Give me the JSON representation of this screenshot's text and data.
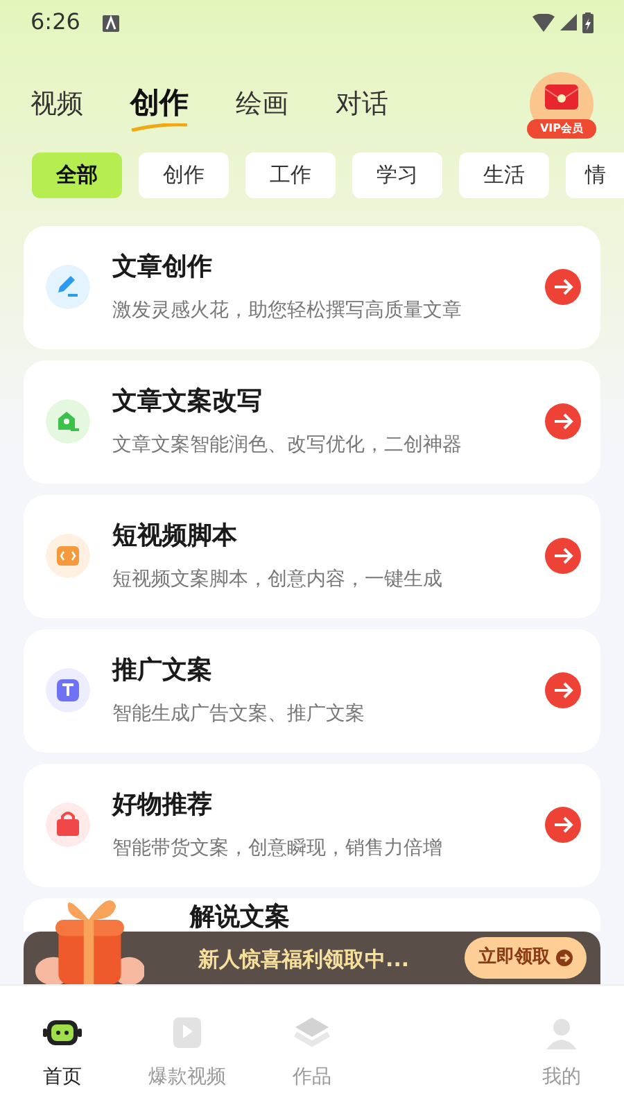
{
  "status_bar": {
    "time": "6:26"
  },
  "top_tabs": [
    {
      "label": "视频",
      "selected": false
    },
    {
      "label": "创作",
      "selected": true
    },
    {
      "label": "绘画",
      "selected": false
    },
    {
      "label": "对话",
      "selected": false
    }
  ],
  "vip_badge": "VIP会员",
  "categories": [
    {
      "label": "全部",
      "selected": true
    },
    {
      "label": "创作",
      "selected": false
    },
    {
      "label": "工作",
      "selected": false
    },
    {
      "label": "学习",
      "selected": false
    },
    {
      "label": "生活",
      "selected": false
    },
    {
      "label": "情",
      "selected": false
    }
  ],
  "tools": [
    {
      "kind": "pencil",
      "title": "文章创作",
      "description": "激发灵感火花，助您轻松撰写高质量文章"
    },
    {
      "kind": "rewrite",
      "title": "文章文案改写",
      "description": "文章文案智能润色、改写优化，二创神器"
    },
    {
      "kind": "code",
      "title": "短视频脚本",
      "description": "短视频文案脚本，创意内容，一键生成"
    },
    {
      "kind": "text",
      "title": "推广文案",
      "description": "智能生成广告文案、推广文案"
    },
    {
      "kind": "bag",
      "title": "好物推荐",
      "description": "智能带货文案，创意瞬现，销售力倍增"
    },
    {
      "kind": "hidden",
      "title": "解说文案"
    }
  ],
  "promo": {
    "text": "新人惊喜福利领取中...",
    "button": "立即领取"
  },
  "bottom_nav": [
    {
      "label": "首页",
      "selected": true,
      "kind": "robot"
    },
    {
      "label": "爆款视频",
      "selected": false,
      "kind": "video"
    },
    {
      "label": "作品",
      "selected": false,
      "kind": "layers"
    },
    {
      "kind": "covered"
    },
    {
      "label": "我的",
      "selected": false,
      "kind": "person"
    }
  ]
}
